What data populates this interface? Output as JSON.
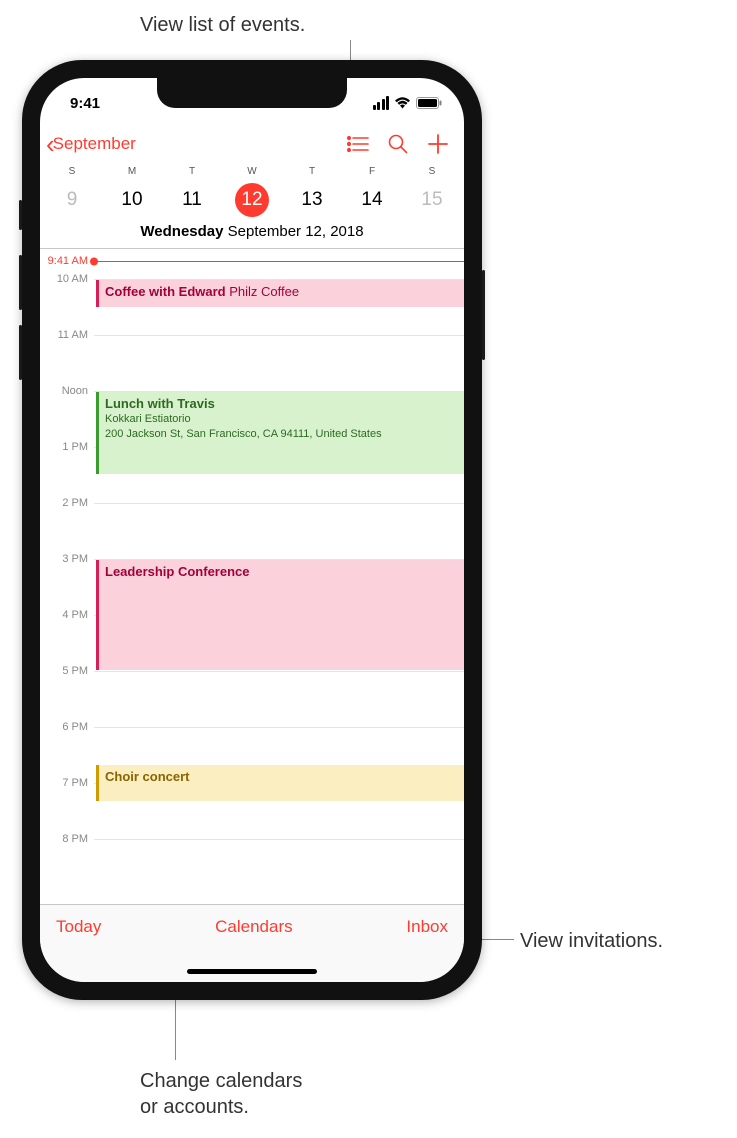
{
  "callouts": {
    "top": "View list of events.",
    "right": "View invitations.",
    "bottom_line1": "Change calendars",
    "bottom_line2": "or accounts."
  },
  "status": {
    "time": "9:41"
  },
  "nav": {
    "back_label": "September"
  },
  "week": {
    "letters": [
      "S",
      "M",
      "T",
      "W",
      "T",
      "F",
      "S"
    ],
    "nums": [
      "9",
      "10",
      "11",
      "12",
      "13",
      "14",
      "15"
    ],
    "selected_index": 3
  },
  "date_label": {
    "weekday": "Wednesday",
    "rest": "  September 12, 2018"
  },
  "timeline": {
    "now_label": "9:41 AM",
    "hours": [
      "10 AM",
      "11 AM",
      "Noon",
      "1 PM",
      "2 PM",
      "3 PM",
      "4 PM",
      "5 PM",
      "6 PM",
      "7 PM",
      "8 PM"
    ]
  },
  "events": {
    "coffee": {
      "title": "Coffee with Edward",
      "loc": " Philz Coffee"
    },
    "lunch": {
      "title": "Lunch with Travis",
      "sub1": "Kokkari Estiatorio",
      "sub2": "200 Jackson St, San Francisco, CA  94111, United States"
    },
    "conf": {
      "title": "Leadership Conference"
    },
    "choir": {
      "title": "Choir concert"
    }
  },
  "toolbar": {
    "today": "Today",
    "calendars": "Calendars",
    "inbox": "Inbox"
  }
}
